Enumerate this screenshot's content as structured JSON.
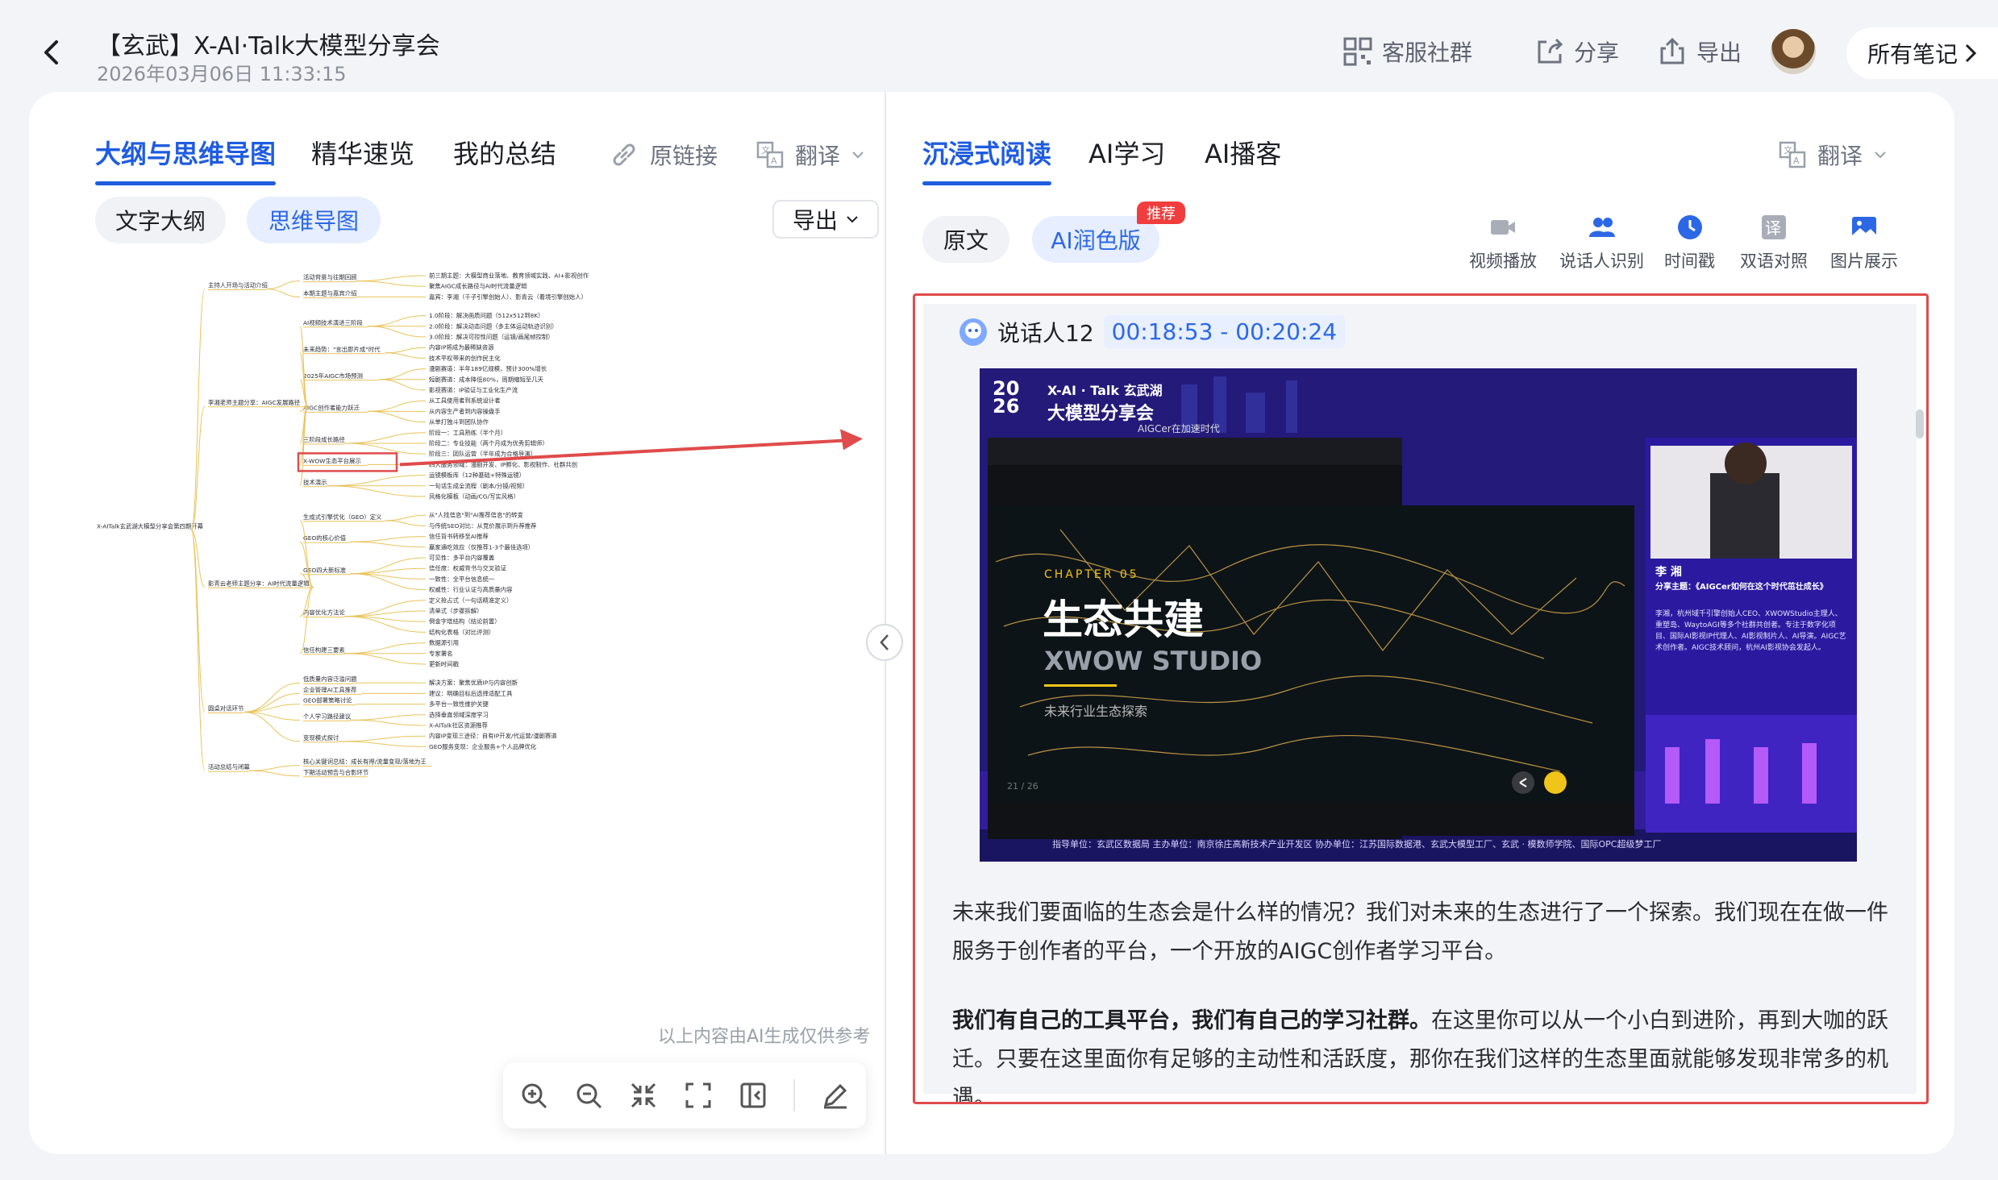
{
  "header": {
    "title": "【玄武】X-AI·Talk大模型分享会",
    "date": "2026年03月06日 11:33:15",
    "actions": {
      "service": "客服社群",
      "share": "分享",
      "export": "导出",
      "all_notes": "所有笔记"
    }
  },
  "left": {
    "tabs": [
      "大纲与思维导图",
      "精华速览",
      "我的总结"
    ],
    "source_link": "原链接",
    "translate": "翻译",
    "subtabs": [
      "文字大纲",
      "思维导图"
    ],
    "export": "导出",
    "disclaimer": "以上内容由AI生成仅供参考",
    "mindmap": {
      "root": "X-AITalk玄武湖大模型分享会第四期开幕",
      "branches": [
        {
          "label": "主持人开场与活动介绍",
          "children": [
            {
              "label": "活动背景与往期回顾",
              "leaves": [
                "前三期主题：大模型商业落地、教育领域实践、AI+影视创作",
                "聚焦AIGC成长路径与AI时代流量逻辑"
              ]
            },
            {
              "label": "本期主题与嘉宾介绍",
              "leaves": [
                "嘉宾：李湘（千子引擎创始人）、影青云（着境引擎创始人）"
              ]
            }
          ]
        },
        {
          "label": "李湘老师主题分享：AIGC发展路径",
          "children": [
            {
              "label": "AI视频技术演进三阶段",
              "leaves": [
                "1.0阶段：解决画质问题（512x512到8K）",
                "2.0阶段：解决动态问题（多主体运动轨迹识别）",
                "3.0阶段：解决可控性问题（运镜/画尾帧控制）"
              ]
            },
            {
              "label": "未来趋势：\"言出即片成\"时代",
              "leaves": [
                "内容IP将成为最稀缺资源",
                "技术平权带来的创作民主化"
              ]
            },
            {
              "label": "2025年AIGC市场预测",
              "leaves": [
                "漫剧赛道：半年189亿规模，预计300%增长",
                "短剧赛道：成本降低80%，周期缩短至几天",
                "影视赛道：IP验证与工业化生产流"
              ]
            },
            {
              "label": "AIGC创作者能力跃迁",
              "leaves": [
                "从工具使用者到系统设计者",
                "从内容生产者到内容操盘手",
                "从单打独斗到团队协作"
              ]
            },
            {
              "label": "三阶段成长路径",
              "leaves": [
                "阶段一：工具熟练（半个月）",
                "阶段二：专业技能（两个月成为优秀剪辑师）",
                "阶段三：团队运营（半年成为合格导演）"
              ]
            },
            {
              "label": "X-WOW生态平台展示",
              "leaves": [
                "四大服务领域：漫剧开发、IP孵化、影视制作、社群共创"
              ]
            },
            {
              "label": "技术演示",
              "leaves": [
                "运镜模板库（12种基础+特殊运镜）",
                "一句话生成全流程（剧本/分镜/视频）",
                "风格化模板（动画/CG/写实风格）"
              ]
            }
          ]
        },
        {
          "label": "影青云老师主题分享：AI时代流量逻辑",
          "children": [
            {
              "label": "生成式引擎优化（GEO）定义",
              "leaves": [
                "从\"人找信息\"到\"AI推荐信息\"的转变",
                "与传统SEO对比：从竞价展示到升荐推荐"
              ]
            },
            {
              "label": "GEO的核心价值",
              "leaves": [
                "信任背书转移至AI推荐",
                "赢家通吃效应（仅推荐1-3个最佳选项）"
              ]
            },
            {
              "label": "GEO四大新标准",
              "leaves": [
                "可见性：多平台内容覆盖",
                "信任度：权威背书与交叉验证",
                "一致性：全平台信息统一",
                "权威性：行业认证与高质量内容"
              ]
            },
            {
              "label": "内容优化方法论",
              "leaves": [
                "定义抢占式（一句话精准定义）",
                "清单式（步骤拆解）",
                "倒金字塔结构（结论前置）",
                "结构化表格（对比评测）"
              ]
            },
            {
              "label": "信任构建三要素",
              "leaves": [
                "数据源引用",
                "专家署名",
                "更新时间戳"
              ]
            }
          ]
        },
        {
          "label": "圆桌对话环节",
          "children": [
            {
              "label": "低质量内容泛滥问题",
              "leaves": [
                "解决方案：聚焦优质IP与内容创新"
              ]
            },
            {
              "label": "企业管理AI工具推荐",
              "leaves": [
                "建议：明确目标后选择适配工具"
              ]
            },
            {
              "label": "GEO部署策略讨论",
              "leaves": [
                "多平台一致性维护关键"
              ]
            },
            {
              "label": "个人学习路径建议",
              "leaves": [
                "选择垂直领域深度学习",
                "X-AITalk社区资源推荐"
              ]
            },
            {
              "label": "变现模式探讨",
              "leaves": [
                "内容IP变现三途径：自有IP开发/代运营/漫剧赛道",
                "GEO服务变现：企业服务+个人品牌优化"
              ]
            }
          ]
        },
        {
          "label": "活动总结与闭幕",
          "children": [
            {
              "label": "核心关键词总结：成长有得/流量变现/落地为王",
              "leaves": []
            },
            {
              "label": "下期活动预告与合影环节",
              "leaves": []
            }
          ]
        }
      ]
    }
  },
  "right": {
    "tabs": [
      "沉浸式阅读",
      "AI学习",
      "AI播客"
    ],
    "translate": "翻译",
    "subtabs": [
      "原文",
      "AI润色版"
    ],
    "badge": "推荐",
    "tools": [
      "视频播放",
      "说话人识别",
      "时间戳",
      "双语对照",
      "图片展示"
    ],
    "speaker": "说话人12",
    "time_range": "00:18:53 - 00:20:24",
    "slide": {
      "year_top": "20",
      "year_bottom": "26",
      "event_line1": "X-AI · Talk 玄武湖",
      "event_line2": "大模型分享会",
      "ui_title": "AIGCer在加速时代",
      "chapter": "CHAPTER 05",
      "heading": "生态共建",
      "brand": "XWOW STUDIO",
      "caption": "未来行业生态探索",
      "page": "21 / 26",
      "speaker_name": "李 湘",
      "topic": "分享主题：《AIGCer如何在这个时代茁壮成长》",
      "bio": "李湘，杭州域千引擎创始人CEO、XWOWStudio主理人、重塑岛、WaytoAGI等多个社群共创者。专注于数字化项目、国际AI影视IP代理人、AI影视制片人、AI导演。AIGC艺术创作者。AIGC技术顾问，杭州AI影视协会发起人。",
      "footer": "指导单位：玄武区数据局    主办单位：南京徐庄高新技术产业开发区    协办单位：江苏国际数据港、玄武大模型工厂、玄武 · 模数师学院、国际OPC超级梦工厂"
    },
    "para1": "未来我们要面临的生态会是什么样的情况？我们对未来的生态进行了一个探索。我们现在在做一件服务于创作者的平台，一个开放的AIGC创作者学习平台。",
    "para2_bold": "我们有自己的工具平台，我们有自己的学习社群。",
    "para2_rest": "在这里你可以从一个小白到进阶，再到大咖的跃迁。只要在这里面你有足够的主动性和活跃度，那你在我们这样的生态里面就能够发现非常多的机遇。"
  },
  "colors": {
    "accent": "#1f5ce0",
    "highlight_border": "#e04b4b",
    "badge": "#f03d3d"
  }
}
